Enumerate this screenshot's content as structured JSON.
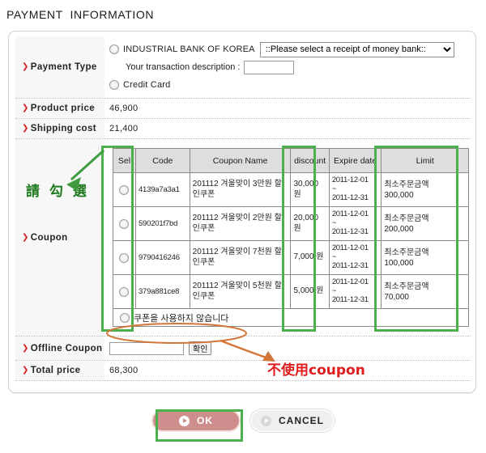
{
  "page": {
    "title": "PAYMENT  INFORMATION"
  },
  "form": {
    "payment_type": {
      "label": "Payment Type",
      "bank_radio_label": "INDUSTRIAL BANK OF KOREA",
      "bank_select_value": "::Please select a receipt of money bank::",
      "transaction_desc_label": "Your transaction description :",
      "transaction_desc_value": "",
      "transaction_desc_placeholder": "",
      "credit_card_label": "Credit Card"
    },
    "product_price": {
      "label": "Product price",
      "value": "46,900"
    },
    "shipping_cost": {
      "label": "Shipping cost",
      "value": "21,400"
    },
    "coupon": {
      "label": "Coupon",
      "headers": [
        "Sel",
        "Code",
        "Coupon Name",
        "discount",
        "Expire\ndate",
        "Limit"
      ],
      "header_sel": "Sel",
      "header_code": "Code",
      "header_name": "Coupon Name",
      "header_discount": "discount",
      "header_expire": "Expire date",
      "header_limit": "Limit",
      "rows": [
        {
          "code": "4139a7a3a1",
          "name": "201112 겨울맞이 3만원 할인쿠폰",
          "discount": "30,000 원",
          "expire_from": "2011-12-01",
          "expire_sep": "~",
          "expire_to": "2011-12-31",
          "limit_label": "최소주문금액",
          "limit_value": "300,000"
        },
        {
          "code": "590201f7bd",
          "name": "201112 겨울맞이 2만원 할인쿠폰",
          "discount": "20,000 원",
          "expire_from": "2011-12-01",
          "expire_sep": "~",
          "expire_to": "2011-12-31",
          "limit_label": "최소주문금액",
          "limit_value": "200,000"
        },
        {
          "code": "9790416246",
          "name": "201112 겨울맞이 7천원 할인쿠폰",
          "discount": "7,000 원",
          "expire_from": "2011-12-01",
          "expire_sep": "~",
          "expire_to": "2011-12-31",
          "limit_label": "최소주문금액",
          "limit_value": "100,000"
        },
        {
          "code": "379a881ce8",
          "name": "201112 겨울맞이 5천원 할인쿠폰",
          "discount": "5,000 원",
          "expire_from": "2011-12-01",
          "expire_sep": "~",
          "expire_to": "2011-12-31",
          "limit_label": "최소주문금액",
          "limit_value": "70,000"
        }
      ],
      "no_coupon_label": "쿠폰을 사용하지 않습니다"
    },
    "offline_coupon": {
      "label": "Offline Coupon",
      "value": "",
      "placeholder": "",
      "confirm_label": "확인"
    },
    "total_price": {
      "label": "Total price",
      "value": "68,300"
    }
  },
  "buttons": {
    "ok_label": "OK",
    "cancel_label": "CANCEL"
  },
  "annotations": {
    "green_text": "請 勾 選",
    "red_text": "不使用coupon"
  },
  "colors": {
    "highlight_green": "#4cb04c",
    "annotation_green": "#1f7a1f",
    "annotation_red": "#e11b1b",
    "annotation_orange": "#d2763a",
    "ok_button": "#cf8e8e",
    "label_bg": "#f7f7f7",
    "table_header_bg": "#dedede"
  }
}
